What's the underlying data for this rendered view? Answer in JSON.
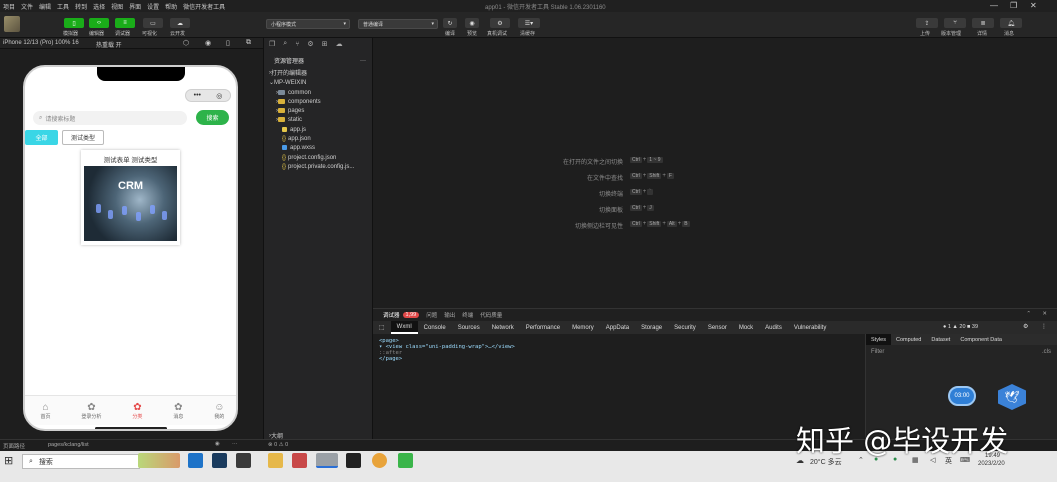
{
  "menubar": {
    "items": [
      "项目",
      "文件",
      "编辑",
      "工具",
      "转到",
      "选择",
      "视图",
      "界面",
      "设置",
      "帮助",
      "微信开发者工具"
    ],
    "title": "app01 - 微信开发者工具 Stable 1.06.2301160",
    "minimize": "—",
    "maximize": "❐",
    "close": "✕"
  },
  "toolbar": {
    "simulator": "模拟器",
    "editor": "编辑器",
    "debugger": "调试器",
    "visual": "可视化",
    "cloud": "云开发",
    "mode_select": "小程序模式",
    "compile_select": "普通编译",
    "compile": "编译",
    "preview": "预览",
    "real_debug": "真机调试",
    "clear_cache": "清缓存",
    "upload": "上传",
    "version": "版本管理",
    "details": "详情",
    "messages": "消息"
  },
  "simbar": {
    "device": "iPhone 12/13 (Pro) 100% 16",
    "hotreload": "热重载 开"
  },
  "phone": {
    "search_placeholder": "请搜索标题",
    "search_button": "搜索",
    "tab_all": "全部",
    "tab_test": "测试类型",
    "card_title": "测试表单 测试类型",
    "card_image_text": "CRM",
    "tabs": [
      {
        "label": "首页",
        "icon": "⌂"
      },
      {
        "label": "登录分析",
        "icon": "✿"
      },
      {
        "label": "分类",
        "icon": "✿"
      },
      {
        "label": "消息",
        "icon": "✿"
      },
      {
        "label": "我的",
        "icon": "☺"
      }
    ]
  },
  "explorer": {
    "header": "资源管理器",
    "open_editors": "打开的编辑器",
    "project": "MP-WEIXIN",
    "items": [
      {
        "name": "common",
        "type": "folder",
        "color": "#7b8a99"
      },
      {
        "name": "components",
        "type": "folder",
        "color": "#d8b13a"
      },
      {
        "name": "pages",
        "type": "folder",
        "color": "#d8b13a"
      },
      {
        "name": "static",
        "type": "folder",
        "color": "#d8b13a"
      },
      {
        "name": "app.js",
        "type": "file",
        "color": "#e6c84a"
      },
      {
        "name": "app.json",
        "type": "file",
        "color": "#e6c84a"
      },
      {
        "name": "app.wxss",
        "type": "file",
        "color": "#4a9ae6"
      },
      {
        "name": "project.config.json",
        "type": "file",
        "color": "#e6c84a"
      },
      {
        "name": "project.private.config.js...",
        "type": "file",
        "color": "#e6c84a"
      }
    ],
    "outline": "大纲",
    "errors": "⊗ 0 ⚠ 0"
  },
  "shortcuts": [
    {
      "label": "在打开的文件之间切换",
      "keys": [
        "Ctrl",
        "1 ~ 9"
      ]
    },
    {
      "label": "在文件中查找",
      "keys": [
        "Ctrl",
        "Shift",
        "F"
      ]
    },
    {
      "label": "切换终端",
      "keys": [
        "Ctrl",
        "`"
      ]
    },
    {
      "label": "切换面板",
      "keys": [
        "Ctrl",
        "J"
      ]
    },
    {
      "label": "切换侧边栏可见性",
      "keys": [
        "Ctrl",
        "Shift",
        "Alt",
        "B"
      ]
    }
  ],
  "devtools": {
    "top_tabs": [
      "调试器",
      "问题",
      "输出",
      "终端",
      "代码质量"
    ],
    "badge": "1,99",
    "tabs": [
      "Wxml",
      "Console",
      "Sources",
      "Network",
      "Performance",
      "Memory",
      "AppData",
      "Storage",
      "Security",
      "Sensor",
      "Mock",
      "Audits",
      "Vulnerability"
    ],
    "counts": "● 1 ▲ 20 ■ 39",
    "dom_lines": [
      "<page>",
      "▾ <view class=\"uni-padding-wrap\">…</view>",
      "    ::after",
      "</page>"
    ],
    "style_tabs": [
      "Styles",
      "Computed",
      "Dataset",
      "Component Data"
    ],
    "filter": "Filter",
    "cls": ".cls",
    "float_badge": "03:00"
  },
  "statusbar": {
    "path_label": "页面路径",
    "path": "pages/kclang/list",
    "errors": "⊗ 0 ⚠ 0"
  },
  "taskbar": {
    "search": "搜索",
    "weather": "20°C 多云",
    "lang": "英",
    "time": "19:49",
    "date": "2023/2/20"
  },
  "watermark": "知乎 @毕设开发"
}
